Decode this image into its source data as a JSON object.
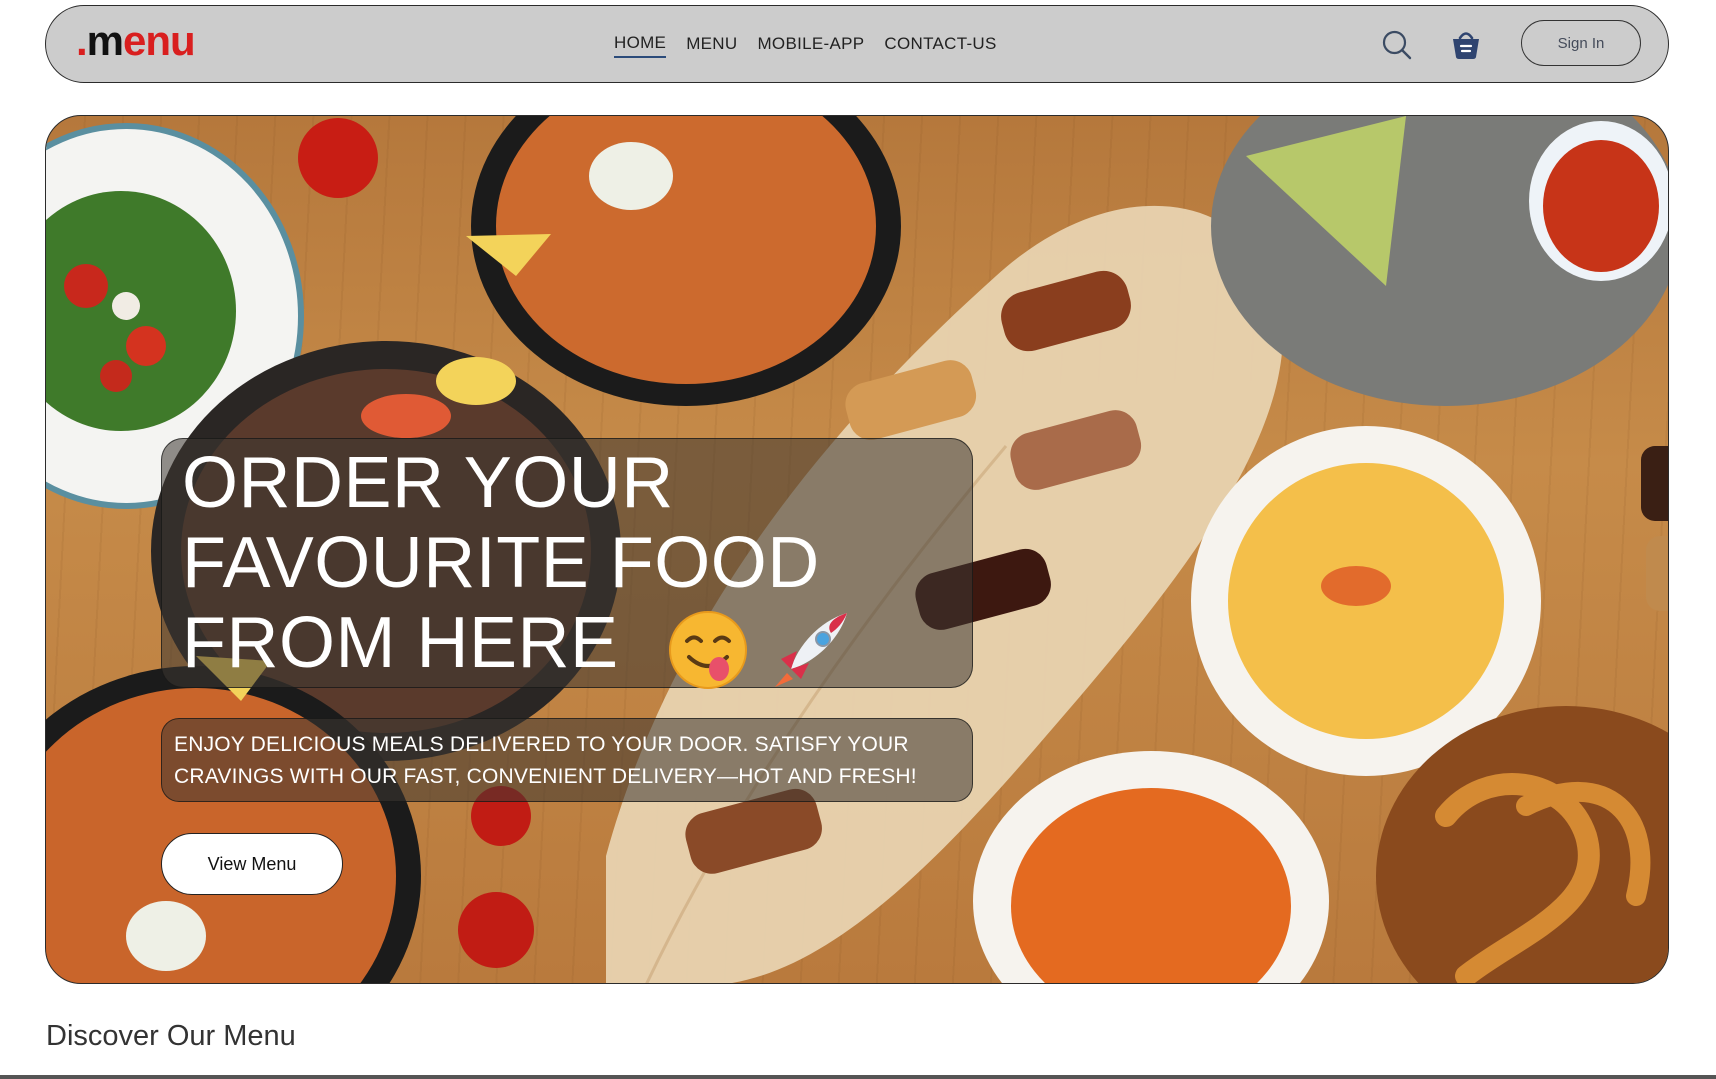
{
  "header": {
    "logo": {
      "dot": ".",
      "m": "m",
      "rest": "enu"
    },
    "nav": [
      {
        "label": "HOME",
        "active": true
      },
      {
        "label": "MENU",
        "active": false
      },
      {
        "label": "MOBILE-APP",
        "active": false
      },
      {
        "label": "CONTACT-US",
        "active": false
      }
    ],
    "search_icon": "search-icon",
    "basket_icon": "basket-icon",
    "sign_in_label": "Sign In"
  },
  "hero": {
    "headline_lines": [
      "ORDER YOUR",
      "FAVOURITE FOOD",
      "FROM HERE"
    ],
    "emojis": [
      "face-savoring-food-emoji",
      "rocket-emoji"
    ],
    "subtext_lines": [
      "ENJOY DELICIOUS MEALS DELIVERED TO YOUR DOOR. SATISFY YOUR",
      "CRAVINGS WITH OUR FAST, CONVENIENT DELIVERY—HOT AND FRESH!"
    ],
    "cta_label": "View Menu"
  },
  "section": {
    "title": "Discover Our Menu"
  },
  "colors": {
    "navbar_bg": "#cccccc",
    "brand_red": "#d91f1f",
    "active_underline": "#2b4b7a",
    "overlay_box": "rgba(60,55,50,0.55)"
  }
}
